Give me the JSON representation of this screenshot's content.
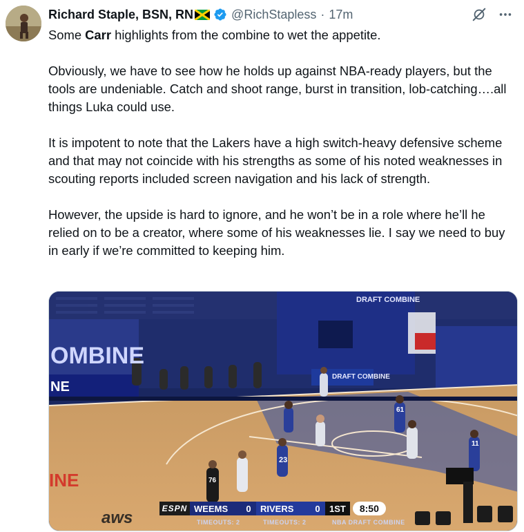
{
  "tweet": {
    "display_name": "Richard Staple, BSN, RN",
    "handle": "@RichStapless",
    "separator": "·",
    "time": "17m",
    "paragraphs": [
      {
        "before": "Some ",
        "bold": "Carr",
        "after": " highlights from the combine to wet the appetite."
      },
      {
        "text": "Obviously, we have to see how he holds up against NBA-ready players, but the tools are undeniable. Catch and shoot range, burst in transition, lob-catching….all things Luka could use."
      },
      {
        "text": "It is impotent to note that the Lakers have a high switch-heavy defensive scheme and that may not coincide with his strengths as some of his noted weaknesses in scouting reports included screen navigation and his lack of strength."
      },
      {
        "text": "However, the upside is hard to ignore, and he won’t be in a role where he’ll he relied on to be a creator, where some of his weaknesses lie. I say we need to buy in early if we’re committed to keeping him."
      }
    ]
  },
  "icons": {
    "verified": "verified-badge-icon",
    "grok": "grok-icon",
    "more": "more-icon",
    "flag": "jamaica-flag-icon"
  },
  "colors": {
    "verified_blue": "#1d9bf0",
    "text": "#0f1419",
    "secondary": "#536471"
  },
  "video": {
    "scorebug": {
      "network": "ESPN",
      "team1": "WEEMS",
      "score1": "0",
      "team2": "RIVERS",
      "score2": "0",
      "period": "1ST",
      "clock": "8:50",
      "timeouts1": "TIMEOUTS: 2",
      "timeouts2": "TIMEOUTS: 2",
      "event": "NBA DRAFT COMBINE"
    },
    "signage": {
      "combine_left": "OMBINE",
      "ne": "NE",
      "draft_combine_top": "DRAFT COMBINE",
      "draft_combine_mid": "DRAFT COMBINE",
      "jersey_76": "76",
      "jersey_23": "23",
      "jersey_61": "61",
      "jersey_11": "11",
      "floor_ine": "INE",
      "aws": "aws"
    }
  }
}
